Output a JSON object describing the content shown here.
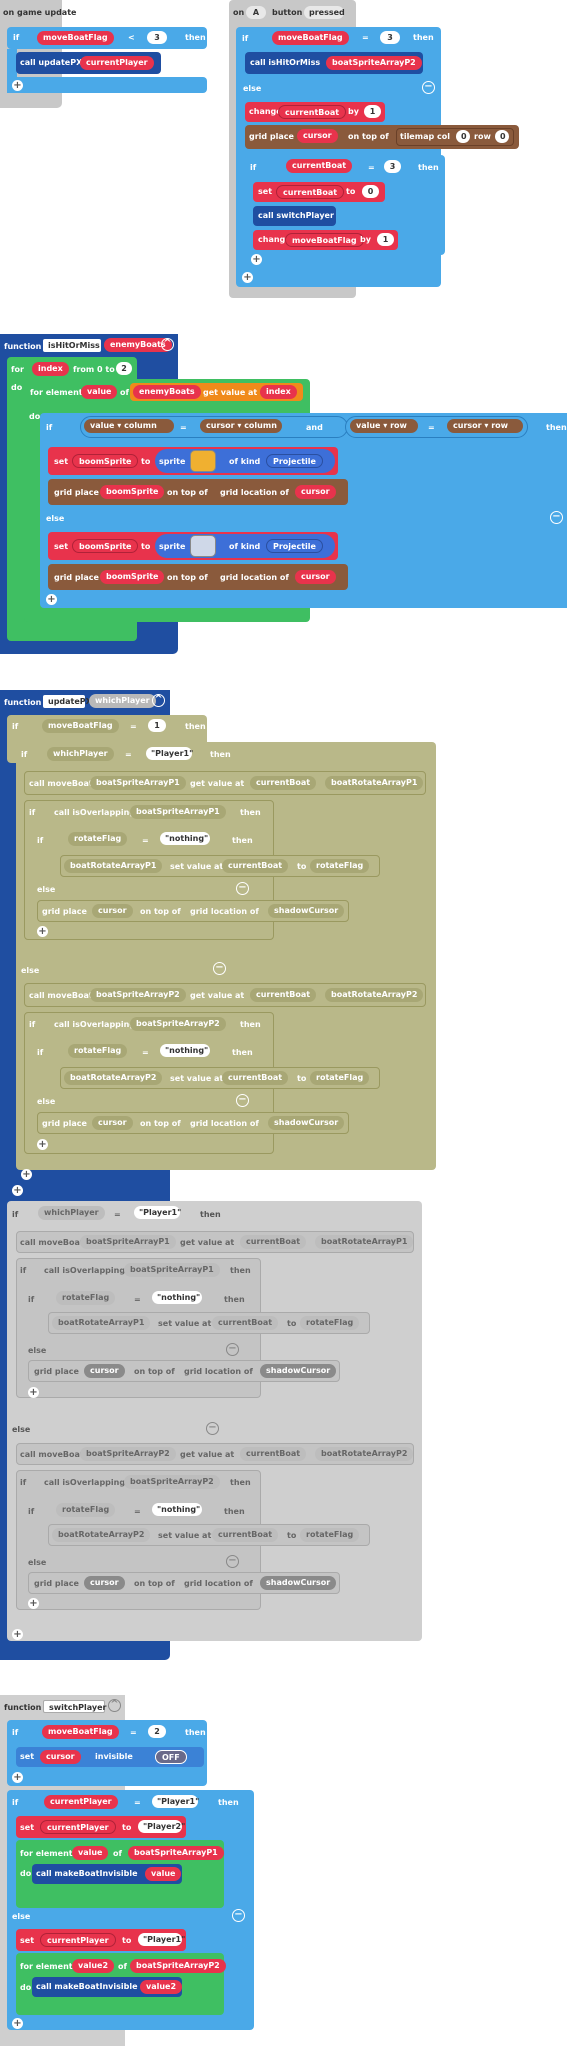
{
  "w1": {
    "header": "on game update",
    "if": "if",
    "var": "moveBoatFlag",
    "op": "<",
    "num": "3",
    "then": "then",
    "call": "call updatePX",
    "arg": "currentPlayer"
  },
  "w2": {
    "header_on": "on",
    "btn": "A",
    "header_btn": "button",
    "event": "pressed",
    "if": "if",
    "var": "moveBoatFlag",
    "op": "=",
    "num": "3",
    "then": "then",
    "call1": "call isHitOrMiss",
    "arg1": "boatSpriteArrayP2",
    "else": "else",
    "change": "change",
    "var2": "currentBoat",
    "by": "by",
    "num2": "1",
    "grid": "grid place",
    "cursor": "cursor",
    "ontop": "on top of",
    "tilemap": "tilemap col",
    "col": "0",
    "row": "row",
    "rowv": "0",
    "if2": "if",
    "var3": "currentBoat",
    "op2": "=",
    "num3": "3",
    "then2": "then",
    "set": "set",
    "var4": "currentBoat",
    "to": "to",
    "num4": "0",
    "call2": "call switchPlayer",
    "change2": "change",
    "var5": "moveBoatFlag",
    "by2": "by",
    "num5": "1"
  },
  "w3": {
    "function": "function",
    "name": "isHitOrMiss",
    "param": "enemyBoats",
    "for": "for",
    "idx": "index",
    "from": "from 0 to",
    "num": "2",
    "do": "do",
    "fe": "for element",
    "val": "value",
    "of": "of",
    "arr": "enemyBoats",
    "getv": "get value at",
    "idx2": "index",
    "if": "if",
    "value": "value",
    "column": "column",
    "eq": "=",
    "cursor": "cursor",
    "and": "and",
    "row": "row",
    "then": "then",
    "set": "set",
    "boom": "boomSprite",
    "to": "to",
    "sprite": "sprite",
    "ofkind": "of kind",
    "kind": "Projectile",
    "grid": "grid place",
    "ontop": "on top of",
    "gridloc": "grid location of",
    "else": "else"
  },
  "w4": {
    "function": "function",
    "name": "updatePX",
    "param": "whichPlayer",
    "if": "if",
    "mbf": "moveBoatFlag",
    "eq": "=",
    "one": "1",
    "then": "then",
    "wp": "whichPlayer",
    "p1": "Player1",
    "call_move": "call moveBoat",
    "bsa1": "boatSpriteArrayP1",
    "bsa2": "boatSpriteArrayP2",
    "getv": "get value at",
    "cb": "currentBoat",
    "bra1": "boatRotateArrayP1",
    "bra2": "boatRotateArrayP2",
    "call_over": "call isOverlapping",
    "rf": "rotateFlag",
    "nothing": "nothing",
    "setv": "set value at",
    "to": "to",
    "else": "else",
    "grid": "grid place",
    "cursor": "cursor",
    "ontop": "on top of",
    "gridloc": "grid location of",
    "shadow": "shadowCursor"
  },
  "w5": {
    "function": "function",
    "name": "switchPlayer",
    "if": "if",
    "mbf": "moveBoatFlag",
    "eq": "=",
    "two": "2",
    "then": "then",
    "set": "set",
    "cursor": "cursor",
    "invisible": "invisible",
    "off": "OFF",
    "cp": "currentPlayer",
    "p1": "Player1",
    "p2": "Player2",
    "to": "to",
    "fe": "for element",
    "val": "value",
    "val2": "value2",
    "of": "of",
    "bsa1": "boatSpriteArrayP1",
    "bsa2": "boatSpriteArrayP2",
    "do": "do",
    "call": "call makeBoatInvisible",
    "else": "else"
  }
}
